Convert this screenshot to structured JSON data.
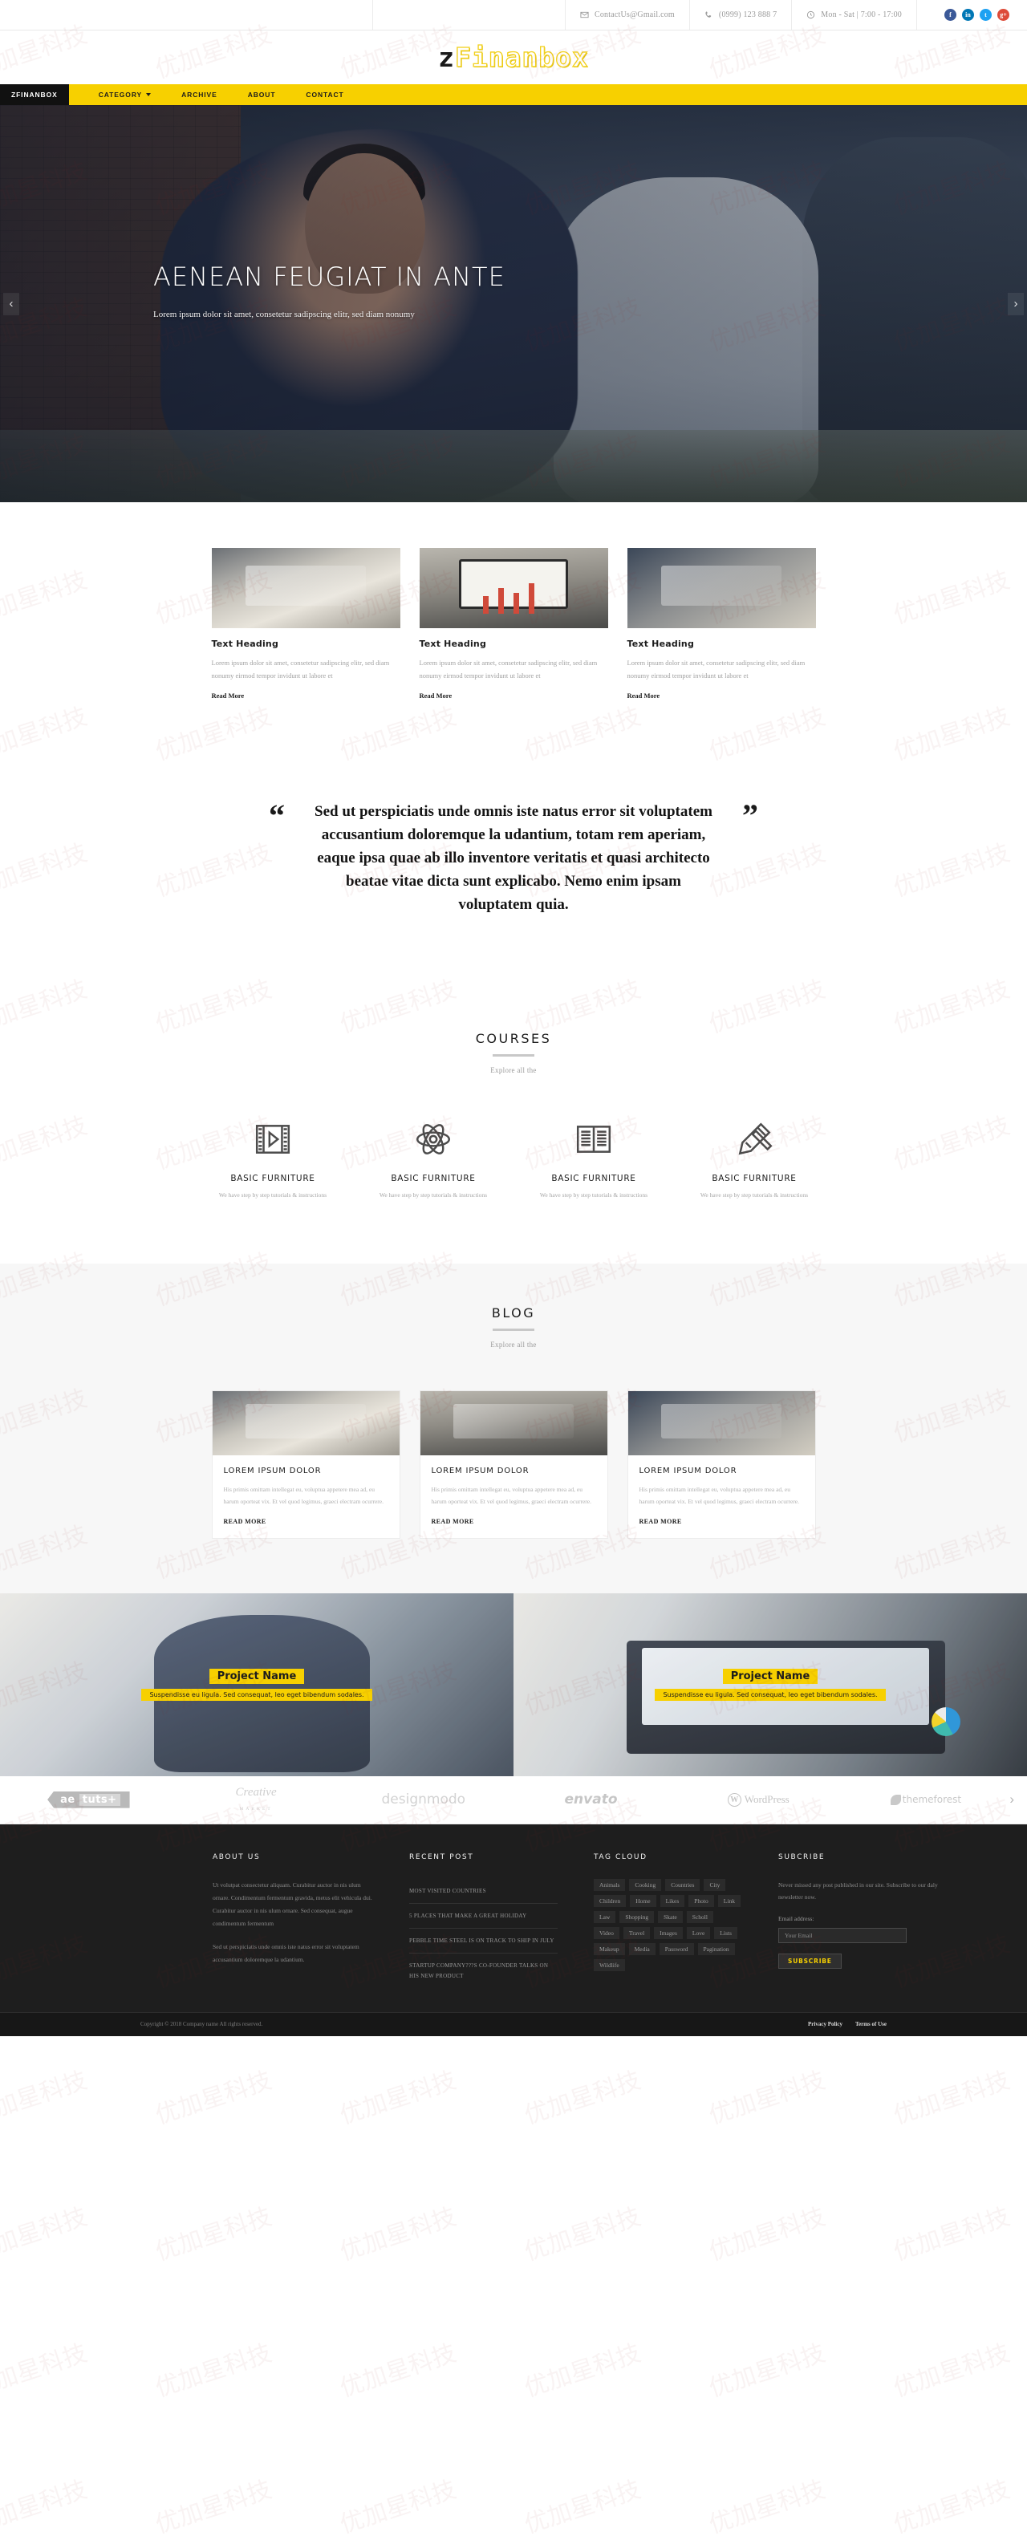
{
  "topbar": {
    "email": "ContactUs@Gmail.com",
    "phone": "(0999) 123 888 7",
    "hours": "Mon - Sat | 7:00 - 17:00",
    "socials": [
      {
        "name": "facebook",
        "glyph": "f",
        "color": "#3b5998"
      },
      {
        "name": "linkedin",
        "glyph": "in",
        "color": "#0077b5"
      },
      {
        "name": "twitter",
        "glyph": "t",
        "color": "#1da1f2"
      },
      {
        "name": "googleplus",
        "glyph": "g+",
        "color": "#dd4b39"
      }
    ]
  },
  "logo": {
    "prefix": "z",
    "name": "Finanbox",
    "accent": "#f2d01a"
  },
  "nav": {
    "brand": "ZFINANBOX",
    "items": [
      {
        "label": "CATEGORY",
        "dropdown": true
      },
      {
        "label": "ARCHIVE",
        "dropdown": false
      },
      {
        "label": "ABOUT",
        "dropdown": false
      },
      {
        "label": "CONTACT",
        "dropdown": false
      }
    ]
  },
  "hero": {
    "title": "AENEAN FEUGIAT IN ANTE",
    "subtitle": "Lorem ipsum dolor sit amet, consetetur sadipscing elitr, sed diam nonumy",
    "prev": "‹",
    "next": "›"
  },
  "features": [
    {
      "title": "Text Heading",
      "text": "Lorem ipsum dolor sit amet, consetetur sadipscing elitr, sed diam nonumy eirmod tempor invidunt ut labore et",
      "more": "Read More"
    },
    {
      "title": "Text Heading",
      "text": "Lorem ipsum dolor sit amet, consetetur sadipscing elitr, sed diam nonumy eirmod tempor invidunt ut labore et",
      "more": "Read More"
    },
    {
      "title": "Text Heading",
      "text": "Lorem ipsum dolor sit amet, consetetur sadipscing elitr, sed diam nonumy eirmod tempor invidunt ut labore et",
      "more": "Read More"
    }
  ],
  "quote": {
    "open": "“",
    "close": "”",
    "text": "Sed ut perspiciatis unde omnis iste natus error sit voluptatem accusantium doloremque la udantium, totam rem aperiam, eaque ipsa quae ab illo inventore veritatis et quasi architecto beatae vitae dicta sunt explicabo. Nemo enim ipsam voluptatem quia."
  },
  "courses": {
    "title": "COURSES",
    "subtitle": "Explore all the",
    "items": [
      {
        "icon": "film-play-icon",
        "name": "BASIC FURNITURE",
        "desc": "We have step by step tutorials & instructions"
      },
      {
        "icon": "atom-icon",
        "name": "BASIC FURNITURE",
        "desc": "We have step by step tutorials & instructions"
      },
      {
        "icon": "open-book-icon",
        "name": "BASIC FURNITURE",
        "desc": "We have step by step tutorials & instructions"
      },
      {
        "icon": "pencil-ruler-icon",
        "name": "BASIC FURNITURE",
        "desc": "We have step by step tutorials & instructions"
      }
    ]
  },
  "blog": {
    "title": "BLOG",
    "subtitle": "Explore all the",
    "posts": [
      {
        "title": "LOREM IPSUM DOLOR",
        "text": "His primis omittam intellegat eu, voluptua appetere mea ad, eu harum oporteat vix. Et vel quod legimus, graeci electram ocurrere.",
        "more": "READ MORE"
      },
      {
        "title": "LOREM IPSUM DOLOR",
        "text": "His primis omittam intellegat eu, voluptua appetere mea ad, eu harum oporteat vix. Et vel quod legimus, graeci electram ocurrere.",
        "more": "READ MORE"
      },
      {
        "title": "LOREM IPSUM DOLOR",
        "text": "His primis omittam intellegat eu, voluptua appetere mea ad, eu harum oporteat vix. Et vel quod legimus, graeci electram ocurrere.",
        "more": "READ MORE"
      }
    ]
  },
  "projects": [
    {
      "name": "Project Name",
      "desc": "Suspendisse eu ligula. Sed consequat, leo eget bibendum sodales."
    },
    {
      "name": "Project Name",
      "desc": "Suspendisse eu ligula. Sed consequat, leo eget bibendum sodales."
    }
  ],
  "clients": {
    "aetuts_a": "ae",
    "aetuts_b": "tuts+",
    "creative_top": "Creative",
    "creative_bottom": "MARKET",
    "designmodo": "designmodo",
    "envato": "envato",
    "wordpress_mark": "W",
    "wordpress": "WordPress",
    "themeforest": "themeforest",
    "next": "›"
  },
  "footer": {
    "about": {
      "heading": "ABOUT US",
      "p1": "Ut volutpat consectetur aliquam. Curabitur auctor in nis ulum ornare. Condimentum fermentum gravida, metus elit vehicula dui. Curabitur auctor in nis ulum ornare. Sed consequat, augue condimentum fermentum",
      "p2": "Sed ut perspiciatis unde omnis iste natus error sit voluptatem accusantium doloremque la udantium."
    },
    "recent": {
      "heading": "RECENT POST",
      "items": [
        "MOST VISITED COUNTRIES",
        "5 PLACES THAT MAKE A GREAT HOLIDAY",
        "PEBBLE TIME STEEL IS ON TRACK TO SHIP IN JULY",
        "STARTUP COMPANY???S CO-FOUNDER TALKS ON HIS NEW PRODUCT"
      ]
    },
    "tags": {
      "heading": "TAG CLOUD",
      "items": [
        "Animals",
        "Cooking",
        "Countries",
        "City",
        "Children",
        "Home",
        "Likes",
        "Photo",
        "Link",
        "Law",
        "Shopping",
        "Skate",
        "Scholl",
        "Video",
        "Travel",
        "Images",
        "Love",
        "Lists",
        "Makeup",
        "Media",
        "Password",
        "Pagination",
        "Wildlife"
      ]
    },
    "subscribe": {
      "heading": "SUBCRIBE",
      "text": "Never missed any post published in our site. Subscribe to our daly newsletter now.",
      "label": "Email address:",
      "placeholder": "Your Email",
      "button": "SUBSCRIBE"
    }
  },
  "bottom": {
    "copyright": "Copyright © 2018 Company name All rights reserved.",
    "links": [
      "Privacy Policy",
      "Terms of Use"
    ]
  }
}
